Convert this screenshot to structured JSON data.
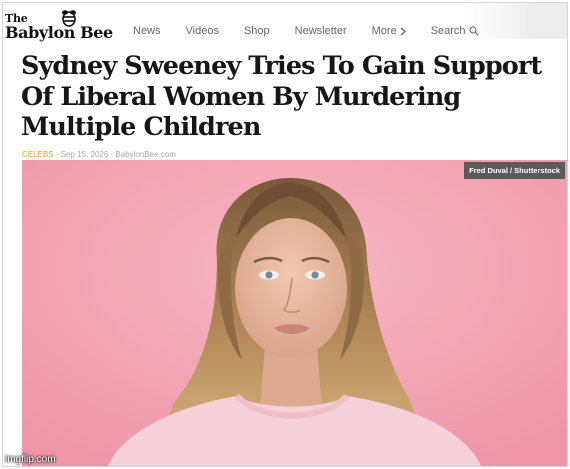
{
  "site": {
    "logo_the": "The",
    "logo_name": "Babylon Bee",
    "logo_icon": "bee-icon"
  },
  "nav": {
    "items": [
      {
        "label": "News"
      },
      {
        "label": "Videos"
      },
      {
        "label": "Shop"
      },
      {
        "label": "Newsletter"
      },
      {
        "label": "More",
        "icon": "chevron-right-icon"
      },
      {
        "label": "Search",
        "icon": "search-icon"
      }
    ]
  },
  "article": {
    "headline": "Sydney Sweeney Tries To Gain Support Of Liberal Women By Murdering Multiple Children",
    "category": "CELEBS",
    "meta_rest": " · Sep 15, 2026 · BabylonBee.com",
    "photo_credit": "Fred Duval / Shutterstock"
  },
  "watermark": "imgflip.com",
  "colors": {
    "category": "#d6a12c",
    "photo_background": "#f3a5b5",
    "credit_badge": "#5a5a5a"
  }
}
